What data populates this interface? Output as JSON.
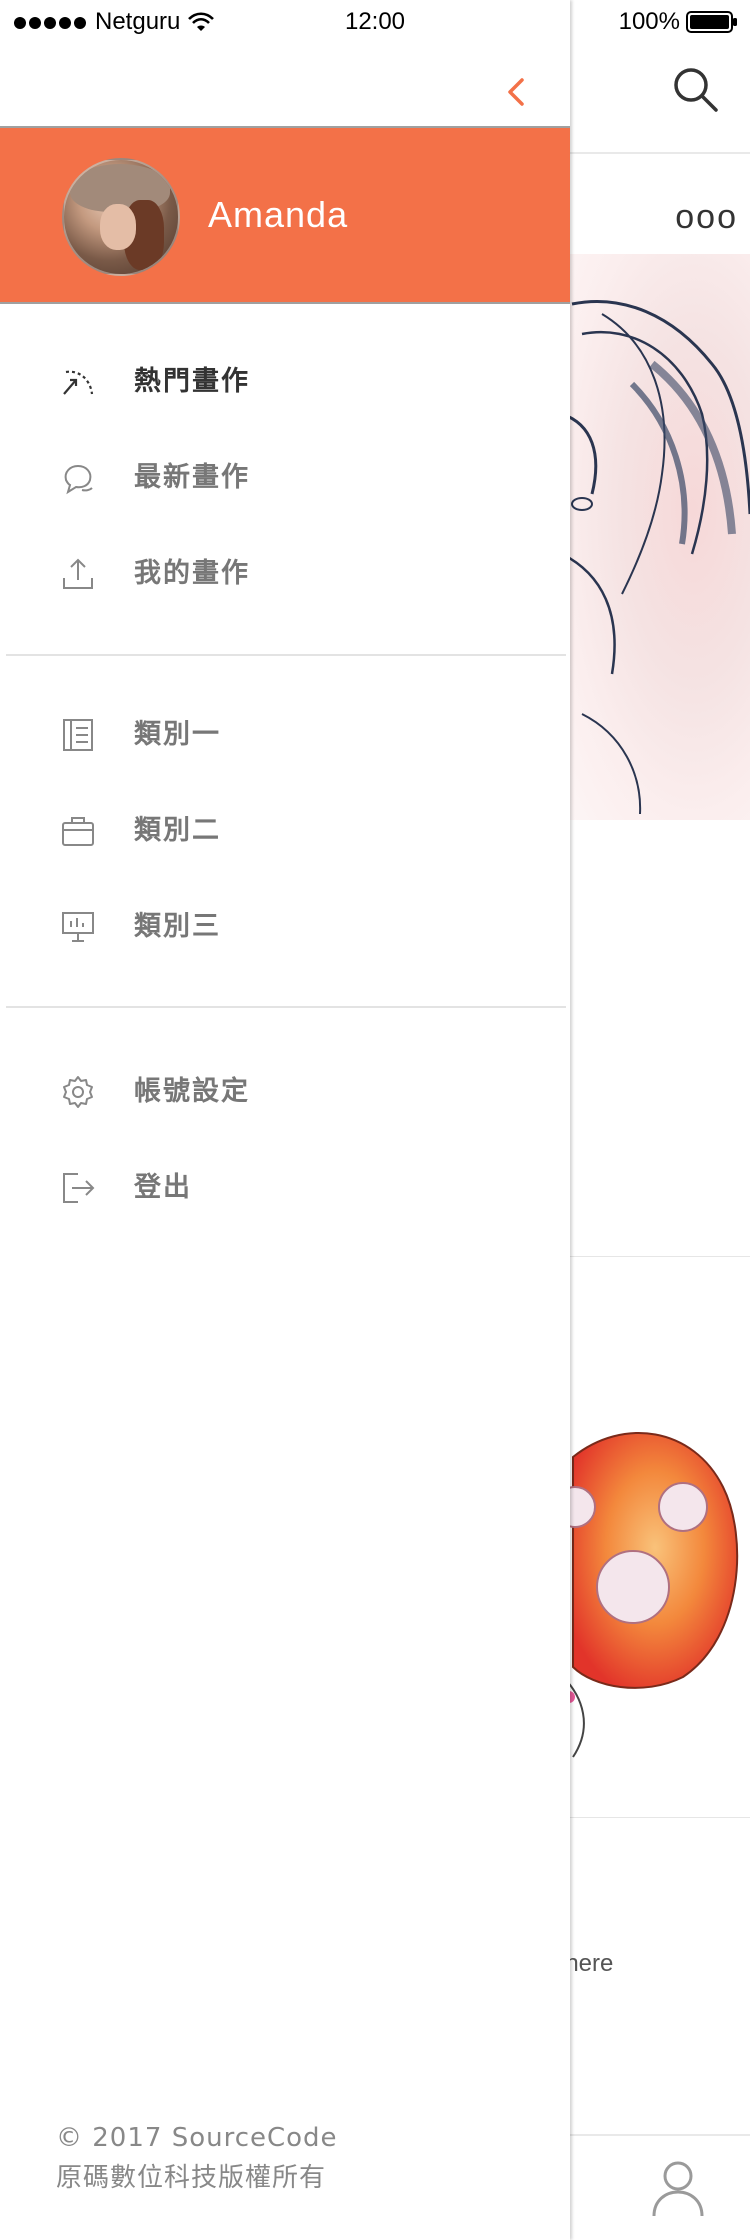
{
  "status_bar": {
    "carrier": "Netguru",
    "time": "12:00",
    "battery": "100%"
  },
  "profile": {
    "name": "Amanda"
  },
  "menu_primary": [
    {
      "label": "熱門畫作",
      "icon": "trending-icon"
    },
    {
      "label": "最新畫作",
      "icon": "chat-bubbles-icon"
    },
    {
      "label": "我的畫作",
      "icon": "upload-icon"
    }
  ],
  "menu_categories": [
    {
      "label": "類別一",
      "icon": "notebook-icon"
    },
    {
      "label": "類別二",
      "icon": "briefcase-icon"
    },
    {
      "label": "類別三",
      "icon": "presentation-icon"
    }
  ],
  "menu_account": [
    {
      "label": "帳號設定",
      "icon": "gear-icon"
    },
    {
      "label": "登出",
      "icon": "logout-icon"
    }
  ],
  "footer": {
    "copyright": "© 2017 SourceCode",
    "rights": "原碼數位科技版權所有"
  },
  "background": {
    "more": "ooo",
    "text1": "e",
    "text2": "where"
  },
  "colors": {
    "accent": "#f37148",
    "drawer_bg": "#ffffff",
    "active_text": "#333333",
    "inactive_text": "#777777"
  }
}
